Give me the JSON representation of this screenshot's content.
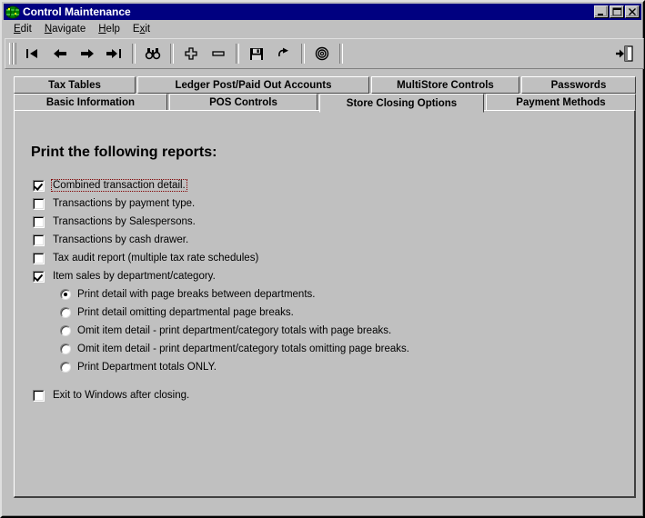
{
  "window": {
    "title": "Control Maintenance",
    "icon": "app-globe-icon",
    "colors": {
      "titlebar": "#000080",
      "face": "#c0c0c0",
      "focus_outline": "#800000"
    },
    "buttons": {
      "minimize": "Minimize",
      "maximize": "Maximize",
      "close": "Close"
    }
  },
  "menu": {
    "items": [
      {
        "label": "Edit",
        "accel": "E"
      },
      {
        "label": "Navigate",
        "accel": "N"
      },
      {
        "label": "Help",
        "accel": "H"
      },
      {
        "label": "Exit",
        "accel": "x"
      }
    ]
  },
  "toolbar": {
    "buttons": [
      {
        "name": "first-record-button",
        "icon": "first-record-icon"
      },
      {
        "name": "previous-record-button",
        "icon": "arrow-left-icon"
      },
      {
        "name": "next-record-button",
        "icon": "arrow-right-icon"
      },
      {
        "name": "last-record-button",
        "icon": "last-record-icon"
      },
      {
        "name": "find-button",
        "icon": "binoculars-icon"
      },
      {
        "name": "add-record-button",
        "icon": "plus-icon"
      },
      {
        "name": "delete-record-button",
        "icon": "minus-icon"
      },
      {
        "name": "save-button",
        "icon": "floppy-disk-icon"
      },
      {
        "name": "refresh-button",
        "icon": "undo-arrow-icon"
      },
      {
        "name": "process-button",
        "icon": "target-circle-icon"
      },
      {
        "name": "exit-button",
        "icon": "exit-door-icon"
      }
    ]
  },
  "tabs": {
    "row1": [
      {
        "label": "Tax Tables",
        "selected": false
      },
      {
        "label": "Ledger Post/Paid Out Accounts",
        "selected": false
      },
      {
        "label": "MultiStore Controls",
        "selected": false
      },
      {
        "label": "Passwords",
        "selected": false
      }
    ],
    "row2": [
      {
        "label": "Basic Information",
        "selected": false
      },
      {
        "label": "POS Controls",
        "selected": false
      },
      {
        "label": "Store Closing Options",
        "selected": true
      },
      {
        "label": "Payment Methods",
        "selected": false
      }
    ]
  },
  "panel": {
    "heading": "Print the following reports:",
    "checkboxes": [
      {
        "label": "Combined transaction detail.",
        "checked": true,
        "focused": true
      },
      {
        "label": "Transactions by payment type.",
        "checked": false,
        "focused": false
      },
      {
        "label": "Transactions by Salespersons.",
        "checked": false,
        "focused": false
      },
      {
        "label": "Transactions by cash drawer.",
        "checked": false,
        "focused": false
      },
      {
        "label": "Tax audit report (multiple tax rate schedules)",
        "checked": false,
        "focused": false
      },
      {
        "label": "Item sales by department/category.",
        "checked": true,
        "focused": false
      }
    ],
    "radios": [
      {
        "label": "Print detail with page breaks between departments.",
        "selected": true
      },
      {
        "label": "Print detail omitting departmental page breaks.",
        "selected": false
      },
      {
        "label": "Omit item detail - print department/category totals with page breaks.",
        "selected": false
      },
      {
        "label": "Omit item detail - print department/category totals omitting page breaks.",
        "selected": false
      },
      {
        "label": "Print Department totals ONLY.",
        "selected": false
      }
    ],
    "exit_checkbox": {
      "label": "Exit to Windows after closing.",
      "checked": false
    }
  }
}
